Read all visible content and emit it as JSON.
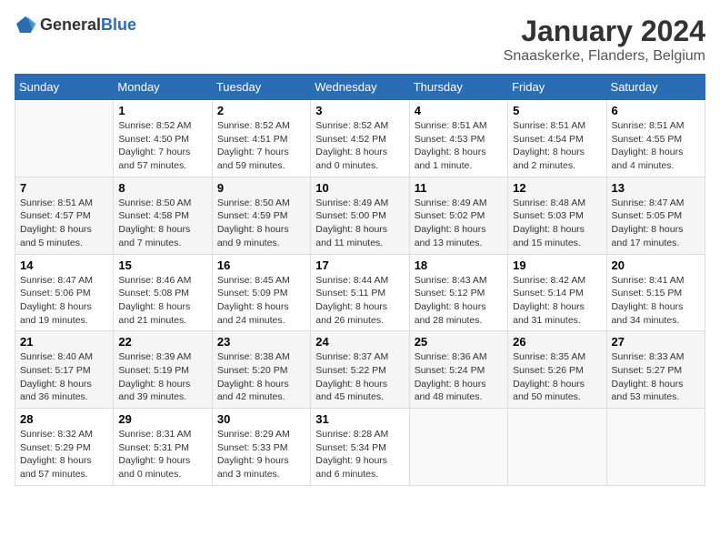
{
  "header": {
    "logo_general": "General",
    "logo_blue": "Blue",
    "month_title": "January 2024",
    "location": "Snaaskerke, Flanders, Belgium"
  },
  "weekdays": [
    "Sunday",
    "Monday",
    "Tuesday",
    "Wednesday",
    "Thursday",
    "Friday",
    "Saturday"
  ],
  "weeks": [
    [
      {
        "day": "",
        "info": ""
      },
      {
        "day": "1",
        "info": "Sunrise: 8:52 AM\nSunset: 4:50 PM\nDaylight: 7 hours\nand 57 minutes."
      },
      {
        "day": "2",
        "info": "Sunrise: 8:52 AM\nSunset: 4:51 PM\nDaylight: 7 hours\nand 59 minutes."
      },
      {
        "day": "3",
        "info": "Sunrise: 8:52 AM\nSunset: 4:52 PM\nDaylight: 8 hours\nand 0 minutes."
      },
      {
        "day": "4",
        "info": "Sunrise: 8:51 AM\nSunset: 4:53 PM\nDaylight: 8 hours\nand 1 minute."
      },
      {
        "day": "5",
        "info": "Sunrise: 8:51 AM\nSunset: 4:54 PM\nDaylight: 8 hours\nand 2 minutes."
      },
      {
        "day": "6",
        "info": "Sunrise: 8:51 AM\nSunset: 4:55 PM\nDaylight: 8 hours\nand 4 minutes."
      }
    ],
    [
      {
        "day": "7",
        "info": "Sunrise: 8:51 AM\nSunset: 4:57 PM\nDaylight: 8 hours\nand 5 minutes."
      },
      {
        "day": "8",
        "info": "Sunrise: 8:50 AM\nSunset: 4:58 PM\nDaylight: 8 hours\nand 7 minutes."
      },
      {
        "day": "9",
        "info": "Sunrise: 8:50 AM\nSunset: 4:59 PM\nDaylight: 8 hours\nand 9 minutes."
      },
      {
        "day": "10",
        "info": "Sunrise: 8:49 AM\nSunset: 5:00 PM\nDaylight: 8 hours\nand 11 minutes."
      },
      {
        "day": "11",
        "info": "Sunrise: 8:49 AM\nSunset: 5:02 PM\nDaylight: 8 hours\nand 13 minutes."
      },
      {
        "day": "12",
        "info": "Sunrise: 8:48 AM\nSunset: 5:03 PM\nDaylight: 8 hours\nand 15 minutes."
      },
      {
        "day": "13",
        "info": "Sunrise: 8:47 AM\nSunset: 5:05 PM\nDaylight: 8 hours\nand 17 minutes."
      }
    ],
    [
      {
        "day": "14",
        "info": "Sunrise: 8:47 AM\nSunset: 5:06 PM\nDaylight: 8 hours\nand 19 minutes."
      },
      {
        "day": "15",
        "info": "Sunrise: 8:46 AM\nSunset: 5:08 PM\nDaylight: 8 hours\nand 21 minutes."
      },
      {
        "day": "16",
        "info": "Sunrise: 8:45 AM\nSunset: 5:09 PM\nDaylight: 8 hours\nand 24 minutes."
      },
      {
        "day": "17",
        "info": "Sunrise: 8:44 AM\nSunset: 5:11 PM\nDaylight: 8 hours\nand 26 minutes."
      },
      {
        "day": "18",
        "info": "Sunrise: 8:43 AM\nSunset: 5:12 PM\nDaylight: 8 hours\nand 28 minutes."
      },
      {
        "day": "19",
        "info": "Sunrise: 8:42 AM\nSunset: 5:14 PM\nDaylight: 8 hours\nand 31 minutes."
      },
      {
        "day": "20",
        "info": "Sunrise: 8:41 AM\nSunset: 5:15 PM\nDaylight: 8 hours\nand 34 minutes."
      }
    ],
    [
      {
        "day": "21",
        "info": "Sunrise: 8:40 AM\nSunset: 5:17 PM\nDaylight: 8 hours\nand 36 minutes."
      },
      {
        "day": "22",
        "info": "Sunrise: 8:39 AM\nSunset: 5:19 PM\nDaylight: 8 hours\nand 39 minutes."
      },
      {
        "day": "23",
        "info": "Sunrise: 8:38 AM\nSunset: 5:20 PM\nDaylight: 8 hours\nand 42 minutes."
      },
      {
        "day": "24",
        "info": "Sunrise: 8:37 AM\nSunset: 5:22 PM\nDaylight: 8 hours\nand 45 minutes."
      },
      {
        "day": "25",
        "info": "Sunrise: 8:36 AM\nSunset: 5:24 PM\nDaylight: 8 hours\nand 48 minutes."
      },
      {
        "day": "26",
        "info": "Sunrise: 8:35 AM\nSunset: 5:26 PM\nDaylight: 8 hours\nand 50 minutes."
      },
      {
        "day": "27",
        "info": "Sunrise: 8:33 AM\nSunset: 5:27 PM\nDaylight: 8 hours\nand 53 minutes."
      }
    ],
    [
      {
        "day": "28",
        "info": "Sunrise: 8:32 AM\nSunset: 5:29 PM\nDaylight: 8 hours\nand 57 minutes."
      },
      {
        "day": "29",
        "info": "Sunrise: 8:31 AM\nSunset: 5:31 PM\nDaylight: 9 hours\nand 0 minutes."
      },
      {
        "day": "30",
        "info": "Sunrise: 8:29 AM\nSunset: 5:33 PM\nDaylight: 9 hours\nand 3 minutes."
      },
      {
        "day": "31",
        "info": "Sunrise: 8:28 AM\nSunset: 5:34 PM\nDaylight: 9 hours\nand 6 minutes."
      },
      {
        "day": "",
        "info": ""
      },
      {
        "day": "",
        "info": ""
      },
      {
        "day": "",
        "info": ""
      }
    ]
  ]
}
